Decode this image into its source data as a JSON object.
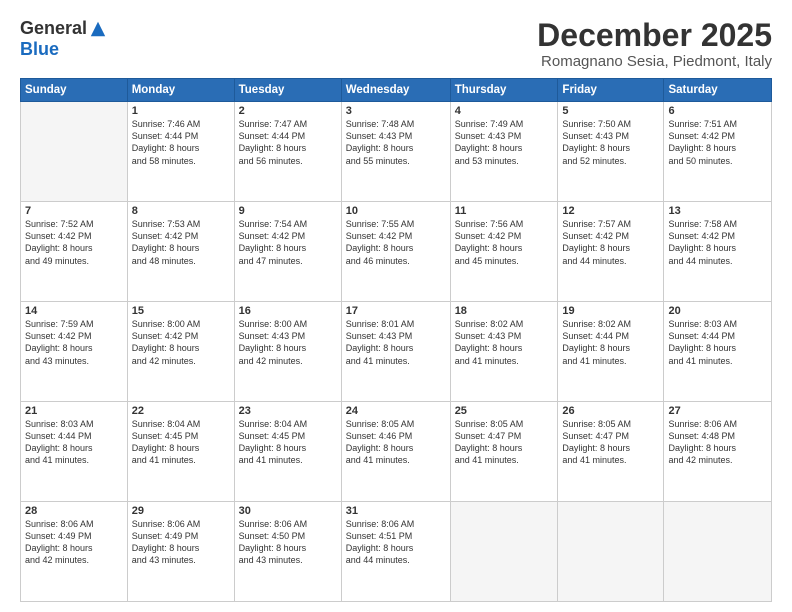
{
  "header": {
    "logo_general": "General",
    "logo_blue": "Blue",
    "month_title": "December 2025",
    "subtitle": "Romagnano Sesia, Piedmont, Italy"
  },
  "weekdays": [
    "Sunday",
    "Monday",
    "Tuesday",
    "Wednesday",
    "Thursday",
    "Friday",
    "Saturday"
  ],
  "weeks": [
    [
      {
        "day": "",
        "content": ""
      },
      {
        "day": "1",
        "content": "Sunrise: 7:46 AM\nSunset: 4:44 PM\nDaylight: 8 hours\nand 58 minutes."
      },
      {
        "day": "2",
        "content": "Sunrise: 7:47 AM\nSunset: 4:44 PM\nDaylight: 8 hours\nand 56 minutes."
      },
      {
        "day": "3",
        "content": "Sunrise: 7:48 AM\nSunset: 4:43 PM\nDaylight: 8 hours\nand 55 minutes."
      },
      {
        "day": "4",
        "content": "Sunrise: 7:49 AM\nSunset: 4:43 PM\nDaylight: 8 hours\nand 53 minutes."
      },
      {
        "day": "5",
        "content": "Sunrise: 7:50 AM\nSunset: 4:43 PM\nDaylight: 8 hours\nand 52 minutes."
      },
      {
        "day": "6",
        "content": "Sunrise: 7:51 AM\nSunset: 4:42 PM\nDaylight: 8 hours\nand 50 minutes."
      }
    ],
    [
      {
        "day": "7",
        "content": "Sunrise: 7:52 AM\nSunset: 4:42 PM\nDaylight: 8 hours\nand 49 minutes."
      },
      {
        "day": "8",
        "content": "Sunrise: 7:53 AM\nSunset: 4:42 PM\nDaylight: 8 hours\nand 48 minutes."
      },
      {
        "day": "9",
        "content": "Sunrise: 7:54 AM\nSunset: 4:42 PM\nDaylight: 8 hours\nand 47 minutes."
      },
      {
        "day": "10",
        "content": "Sunrise: 7:55 AM\nSunset: 4:42 PM\nDaylight: 8 hours\nand 46 minutes."
      },
      {
        "day": "11",
        "content": "Sunrise: 7:56 AM\nSunset: 4:42 PM\nDaylight: 8 hours\nand 45 minutes."
      },
      {
        "day": "12",
        "content": "Sunrise: 7:57 AM\nSunset: 4:42 PM\nDaylight: 8 hours\nand 44 minutes."
      },
      {
        "day": "13",
        "content": "Sunrise: 7:58 AM\nSunset: 4:42 PM\nDaylight: 8 hours\nand 44 minutes."
      }
    ],
    [
      {
        "day": "14",
        "content": "Sunrise: 7:59 AM\nSunset: 4:42 PM\nDaylight: 8 hours\nand 43 minutes."
      },
      {
        "day": "15",
        "content": "Sunrise: 8:00 AM\nSunset: 4:42 PM\nDaylight: 8 hours\nand 42 minutes."
      },
      {
        "day": "16",
        "content": "Sunrise: 8:00 AM\nSunset: 4:43 PM\nDaylight: 8 hours\nand 42 minutes."
      },
      {
        "day": "17",
        "content": "Sunrise: 8:01 AM\nSunset: 4:43 PM\nDaylight: 8 hours\nand 41 minutes."
      },
      {
        "day": "18",
        "content": "Sunrise: 8:02 AM\nSunset: 4:43 PM\nDaylight: 8 hours\nand 41 minutes."
      },
      {
        "day": "19",
        "content": "Sunrise: 8:02 AM\nSunset: 4:44 PM\nDaylight: 8 hours\nand 41 minutes."
      },
      {
        "day": "20",
        "content": "Sunrise: 8:03 AM\nSunset: 4:44 PM\nDaylight: 8 hours\nand 41 minutes."
      }
    ],
    [
      {
        "day": "21",
        "content": "Sunrise: 8:03 AM\nSunset: 4:44 PM\nDaylight: 8 hours\nand 41 minutes."
      },
      {
        "day": "22",
        "content": "Sunrise: 8:04 AM\nSunset: 4:45 PM\nDaylight: 8 hours\nand 41 minutes."
      },
      {
        "day": "23",
        "content": "Sunrise: 8:04 AM\nSunset: 4:45 PM\nDaylight: 8 hours\nand 41 minutes."
      },
      {
        "day": "24",
        "content": "Sunrise: 8:05 AM\nSunset: 4:46 PM\nDaylight: 8 hours\nand 41 minutes."
      },
      {
        "day": "25",
        "content": "Sunrise: 8:05 AM\nSunset: 4:47 PM\nDaylight: 8 hours\nand 41 minutes."
      },
      {
        "day": "26",
        "content": "Sunrise: 8:05 AM\nSunset: 4:47 PM\nDaylight: 8 hours\nand 41 minutes."
      },
      {
        "day": "27",
        "content": "Sunrise: 8:06 AM\nSunset: 4:48 PM\nDaylight: 8 hours\nand 42 minutes."
      }
    ],
    [
      {
        "day": "28",
        "content": "Sunrise: 8:06 AM\nSunset: 4:49 PM\nDaylight: 8 hours\nand 42 minutes."
      },
      {
        "day": "29",
        "content": "Sunrise: 8:06 AM\nSunset: 4:49 PM\nDaylight: 8 hours\nand 43 minutes."
      },
      {
        "day": "30",
        "content": "Sunrise: 8:06 AM\nSunset: 4:50 PM\nDaylight: 8 hours\nand 43 minutes."
      },
      {
        "day": "31",
        "content": "Sunrise: 8:06 AM\nSunset: 4:51 PM\nDaylight: 8 hours\nand 44 minutes."
      },
      {
        "day": "",
        "content": ""
      },
      {
        "day": "",
        "content": ""
      },
      {
        "day": "",
        "content": ""
      }
    ]
  ]
}
